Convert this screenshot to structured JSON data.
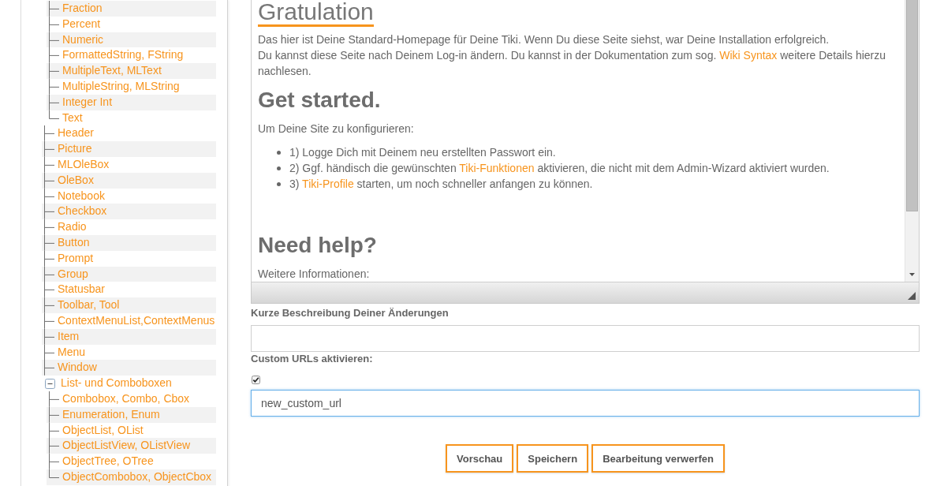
{
  "tree": {
    "items": [
      {
        "children": [
          {
            "label": "Fraction"
          },
          {
            "label": "Percent"
          },
          {
            "label": "Numeric"
          },
          {
            "label": "FormattedString, FString"
          },
          {
            "label": "MultipleText, MLText"
          },
          {
            "label": "MultipleString, MLString"
          },
          {
            "label": "Integer Int"
          },
          {
            "label": "Text"
          }
        ]
      },
      {
        "label": "Header"
      },
      {
        "label": "Picture"
      },
      {
        "label": "MLOleBox"
      },
      {
        "label": "OleBox"
      },
      {
        "label": "Notebook"
      },
      {
        "label": "Checkbox"
      },
      {
        "label": "Radio"
      },
      {
        "label": "Button"
      },
      {
        "label": "Prompt"
      },
      {
        "label": "Group"
      },
      {
        "label": "Statusbar"
      },
      {
        "label": "Toolbar, Tool"
      },
      {
        "label": "ContextMenuList,ContextMenus"
      },
      {
        "label": "Item"
      },
      {
        "label": "Menu"
      },
      {
        "label": "Window"
      },
      {
        "label": "List- und Comboboxen",
        "expanded": true,
        "children": [
          {
            "label": "Combobox, Combo, Cbox"
          },
          {
            "label": "Enumeration, Enum"
          },
          {
            "label": "ObjectList, OList"
          },
          {
            "label": "ObjectListView, OListView"
          },
          {
            "label": "ObjectTree, OTree"
          },
          {
            "label": "ObjectCombobox, ObjectCbox"
          }
        ]
      }
    ]
  },
  "editor": {
    "content": [
      {
        "kind": "title",
        "text": "Gratulation"
      },
      {
        "kind": "paragraph",
        "parts": [
          {
            "kind": "text",
            "text": "Das hier ist Deine Standard-Homepage für Deine Tiki. Wenn Du diese Seite siehst, war Deine Installation erfolgreich."
          }
        ]
      },
      {
        "kind": "paragraph",
        "parts": [
          {
            "kind": "text",
            "text": "Du kannst diese Seite nach Deinem Log-in ändern. Du kannst in der Dokumentation zum sog. "
          },
          {
            "kind": "link",
            "text": "Wiki Syntax"
          },
          {
            "kind": "text",
            "text": " weitere Details hierzu nachlesen."
          }
        ]
      },
      {
        "kind": "heading",
        "text": "Get started."
      },
      {
        "kind": "paragraph",
        "parts": [
          {
            "kind": "text",
            "text": "Um Deine Site zu konfigurieren:"
          }
        ]
      },
      {
        "kind": "list",
        "items": [
          {
            "parts": [
              {
                "kind": "text",
                "text": "1) Logge Dich mit Deinem neu erstellten Passwort ein."
              }
            ]
          },
          {
            "parts": [
              {
                "kind": "text",
                "text": "2) Ggf. händisch die gewünschten "
              },
              {
                "kind": "link",
                "text": "Tiki-Funktionen"
              },
              {
                "kind": "text",
                "text": " aktivieren, die nicht mit dem Admin-Wizard aktiviert wurden."
              }
            ]
          },
          {
            "parts": [
              {
                "kind": "text",
                "text": "3) "
              },
              {
                "kind": "link",
                "text": "Tiki-Profile"
              },
              {
                "kind": "text",
                "text": " starten, um noch schneller anfangen zu können."
              }
            ]
          }
        ]
      },
      {
        "kind": "heading",
        "text": "Need help?"
      },
      {
        "kind": "paragraph",
        "parts": [
          {
            "kind": "text",
            "text": "Weitere Informationen:"
          }
        ]
      }
    ]
  },
  "summary": {
    "label": "Kurze Beschreibung Deiner Änderungen"
  },
  "custom_urls": {
    "label": "Custom URLs aktivieren:",
    "checked": true,
    "url": {
      "value": "new_custom_url",
      "focused": true
    }
  },
  "buttons": [
    {
      "label": "Vorschau"
    },
    {
      "label": "Speichern"
    },
    {
      "label": "Bearbeitung verwerfen"
    }
  ]
}
